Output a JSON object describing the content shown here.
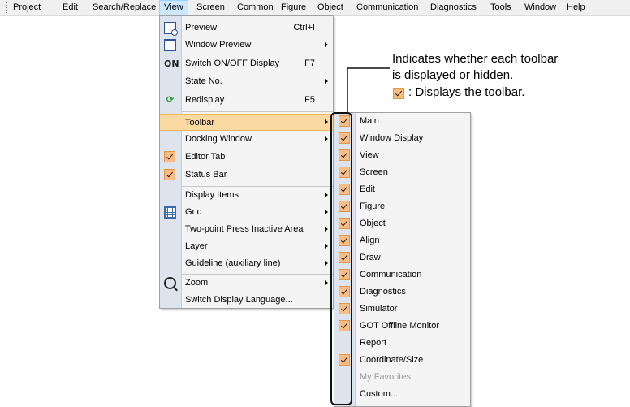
{
  "menubar": {
    "items": [
      "Project",
      "Edit",
      "Search/Replace",
      "View",
      "Screen",
      "Common",
      "Figure",
      "Object",
      "Communication",
      "Diagnostics",
      "Tools",
      "Window",
      "Help"
    ],
    "active": "View"
  },
  "view_menu": {
    "items": [
      {
        "label": "Preview",
        "shortcut": "Ctrl+I",
        "icon": "preview-icon"
      },
      {
        "label": "Window Preview",
        "submenu": true,
        "icon": "window-preview-icon"
      },
      {
        "label": "Switch ON/OFF Display",
        "shortcut": "F7",
        "icon": "on-icon",
        "icon_text": "ON"
      },
      {
        "label": "State No.",
        "submenu": true
      },
      {
        "label": "Redisplay",
        "shortcut": "F5",
        "icon": "redisplay-icon"
      },
      {
        "label": "Toolbar",
        "submenu": true,
        "highlighted": true
      },
      {
        "label": "Docking Window",
        "submenu": true
      },
      {
        "label": "Editor Tab",
        "checked": true
      },
      {
        "label": "Status Bar",
        "checked": true
      },
      {
        "label": "Display Items",
        "submenu": true
      },
      {
        "label": "Grid",
        "submenu": true,
        "icon": "grid-icon"
      },
      {
        "label": "Two-point Press Inactive Area",
        "submenu": true
      },
      {
        "label": "Layer",
        "submenu": true
      },
      {
        "label": "Guideline (auxiliary line)",
        "submenu": true
      },
      {
        "label": "Zoom",
        "submenu": true,
        "icon": "zoom-icon"
      },
      {
        "label": "Switch Display Language..."
      }
    ]
  },
  "toolbar_menu": {
    "items": [
      {
        "label": "Main",
        "checked": true
      },
      {
        "label": "Window Display",
        "checked": true
      },
      {
        "label": "View",
        "checked": true
      },
      {
        "label": "Screen",
        "checked": true
      },
      {
        "label": "Edit",
        "checked": true
      },
      {
        "label": "Figure",
        "checked": true
      },
      {
        "label": "Object",
        "checked": true
      },
      {
        "label": "Align",
        "checked": true
      },
      {
        "label": "Draw",
        "checked": true
      },
      {
        "label": "Communication",
        "checked": true
      },
      {
        "label": "Diagnostics",
        "checked": true
      },
      {
        "label": "Simulator",
        "checked": true
      },
      {
        "label": "GOT Offline Monitor",
        "checked": true
      },
      {
        "label": "Report",
        "checked": false
      },
      {
        "label": "Coordinate/Size",
        "checked": true
      },
      {
        "label": "My Favorites",
        "checked": false,
        "disabled": true
      },
      {
        "label": "Custom...",
        "checked": false
      }
    ]
  },
  "callout": {
    "line1": "Indicates whether each toolbar",
    "line2": "is displayed or hidden.",
    "legend_text": ": Displays the toolbar."
  },
  "colors": {
    "highlight": "#fbd9a3",
    "check_fill": "#fbbd81",
    "icon_strip": "#dde4ee"
  }
}
